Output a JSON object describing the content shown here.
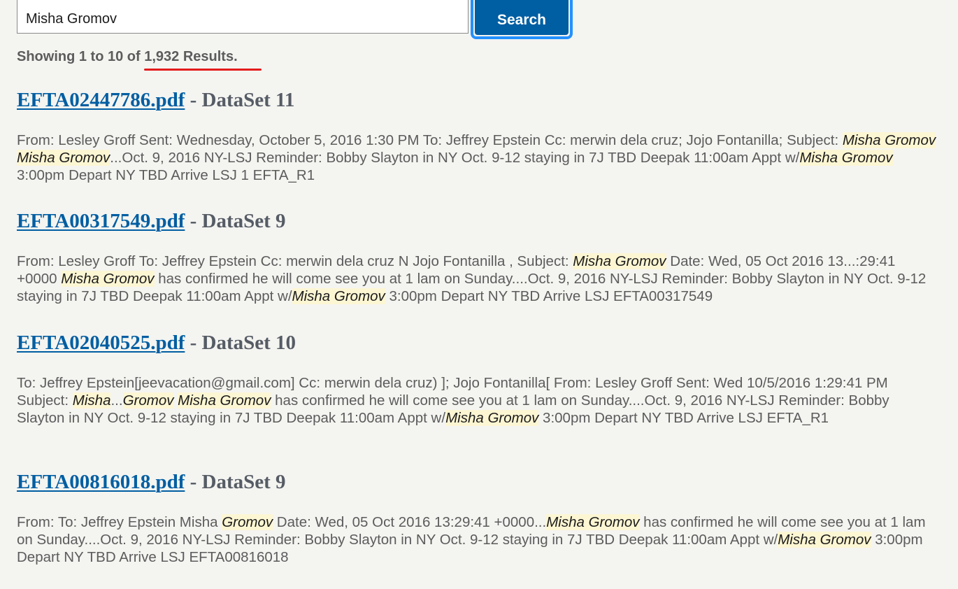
{
  "search": {
    "query": "Misha Gromov",
    "button_label": "Search"
  },
  "summary": {
    "text": "Showing 1 to 10 of 1,932 Results."
  },
  "colors": {
    "link": "#005ea2",
    "button_bg": "#005ea2",
    "focus_ring": "#2491ff",
    "highlight_bg": "#fdf6d3",
    "annotation_underline": "#e31b1b",
    "page_bg": "#f4f4f1"
  },
  "results": [
    {
      "filename": "EFTA02447786.pdf",
      "dataset": " - DataSet 11",
      "snippet": [
        {
          "t": "From: Lesley Groff Sent: Wednesday, October 5, 2016 1:30 PM To: Jeffrey Epstein Cc: merwin dela cruz; Jojo Fontanilla; Subject: "
        },
        {
          "t": "Misha Gromov",
          "h": true
        },
        {
          "t": " "
        },
        {
          "t": "Misha Gromov",
          "h": true
        },
        {
          "t": "...Oct. 9, 2016 NY-LSJ Reminder: Bobby Slayton in NY Oct. 9-12 staying in 7J TBD Deepak 11:00am Appt w/"
        },
        {
          "t": "Misha Gromov",
          "h": true
        },
        {
          "t": " 3:00pm Depart NY TBD Arrive LSJ 1 EFTA_R1"
        }
      ]
    },
    {
      "filename": "EFTA00317549.pdf",
      "dataset": " - DataSet 9",
      "snippet": [
        {
          "t": "From: Lesley Groff To: Jeffrey Epstein Cc: merwin dela cruz N Jojo Fontanilla , Subject: "
        },
        {
          "t": "Misha Gromov",
          "h": true
        },
        {
          "t": " Date: Wed, 05 Oct 2016 13...:29:41 +0000 "
        },
        {
          "t": "Misha Gromov",
          "h": true
        },
        {
          "t": " has confirmed he will come see you at 1 lam on Sunday....Oct. 9, 2016 NY-LSJ Reminder: Bobby Slayton in NY Oct. 9-12 staying in 7J TBD Deepak 11:00am Appt w/"
        },
        {
          "t": "Misha Gromov",
          "h": true
        },
        {
          "t": " 3:00pm Depart NY TBD Arrive LSJ EFTA00317549"
        }
      ]
    },
    {
      "filename": "EFTA02040525.pdf",
      "dataset": " - DataSet 10",
      "snippet": [
        {
          "t": "To: Jeffrey Epstein[jeevacation@gmail.com] Cc: merwin dela cruz) ]; Jojo Fontanilla[ From: Lesley Groff Sent: Wed 10/5/2016 1:29:41 PM Subject: "
        },
        {
          "t": "Misha",
          "h": true
        },
        {
          "t": "..."
        },
        {
          "t": "Gromov",
          "h": true
        },
        {
          "t": " "
        },
        {
          "t": "Misha Gromov",
          "h": true
        },
        {
          "t": " has confirmed he will come see you at 1 lam on Sunday....Oct. 9, 2016 NY-LSJ Reminder: Bobby Slayton in NY Oct. 9-12 staying in 7J TBD Deepak 11:00am Appt w/"
        },
        {
          "t": "Misha Gromov",
          "h": true
        },
        {
          "t": " 3:00pm Depart NY TBD Arrive LSJ EFTA_R1"
        }
      ]
    },
    {
      "filename": "EFTA00816018.pdf",
      "dataset": " - DataSet 9",
      "snippet": [
        {
          "t": "From: To: Jeffrey Epstein Misha "
        },
        {
          "t": "Gromov",
          "h": true
        },
        {
          "t": " Date: Wed, 05 Oct 2016 13:29:41 +0000..."
        },
        {
          "t": "Misha Gromov",
          "h": true
        },
        {
          "t": " has confirmed he will come see you at 1 lam on Sunday....Oct. 9, 2016 NY-LSJ Reminder: Bobby Slayton in NY Oct. 9-12 staying in 7J TBD Deepak 11:00am Appt w/"
        },
        {
          "t": "Misha Gromov",
          "h": true
        },
        {
          "t": " 3:00pm Depart NY TBD Arrive LSJ EFTA00816018"
        }
      ]
    }
  ]
}
